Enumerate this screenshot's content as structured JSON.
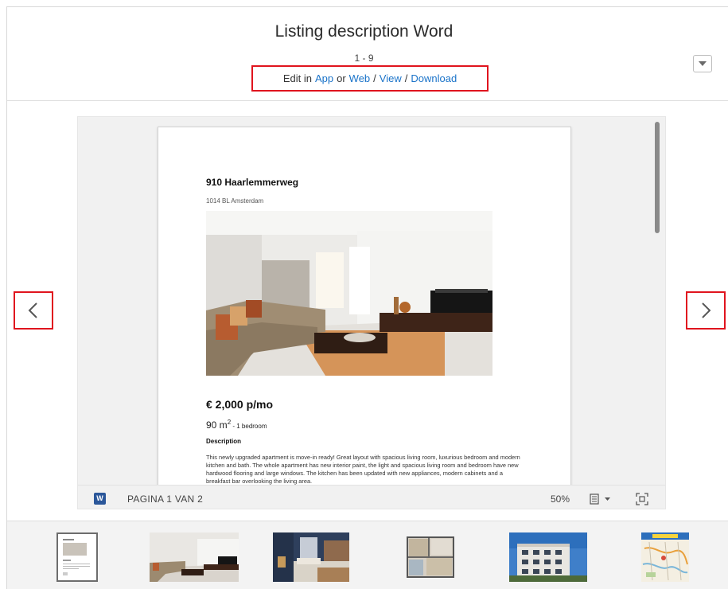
{
  "header": {
    "title": "Listing description Word",
    "count": "1 - 9",
    "edit_prefix": "Edit in",
    "app_link": "App",
    "or_text": "or",
    "web_link": "Web",
    "sep1": "/",
    "view_link": "View",
    "sep2": "/",
    "download_link": "Download"
  },
  "document": {
    "address": "910 Haarlemmerweg",
    "city": "1014 BL Amsterdam",
    "price": "€ 2,000 p/mo",
    "size_value": "90 m",
    "size_sup": "2",
    "rooms": " - 1 bedroom",
    "description_heading": "Description",
    "description_text": "This newly upgraded apartment is move-in ready! Great layout with spacious living room, luxurious bedroom and modern kitchen and bath. The whole apartment has new interior paint, the light and spacious living room and bedroom have new hardwood flooring and large windows. The kitchen has been updated with new appliances, modern cabinets and a breakfast bar overlooking the living area."
  },
  "statusbar": {
    "app_icon_letter": "W",
    "page_label": "PAGINA 1 VAN 2",
    "zoom": "50%"
  },
  "icons": {
    "prev": "chevron-left-icon",
    "next": "chevron-right-icon",
    "dropdown": "caret-down-icon",
    "view_mode": "document-view-icon",
    "fit": "fit-screen-icon",
    "word": "word-app-icon"
  },
  "colors": {
    "link": "#1a73c9",
    "highlight_border": "#e0141e",
    "word_blue": "#2b579a"
  },
  "thumbnails": [
    {
      "kind": "document-page"
    },
    {
      "kind": "living-room-photo"
    },
    {
      "kind": "bedroom-photo"
    },
    {
      "kind": "floor-plan"
    },
    {
      "kind": "building-exterior-photo"
    },
    {
      "kind": "map"
    }
  ]
}
